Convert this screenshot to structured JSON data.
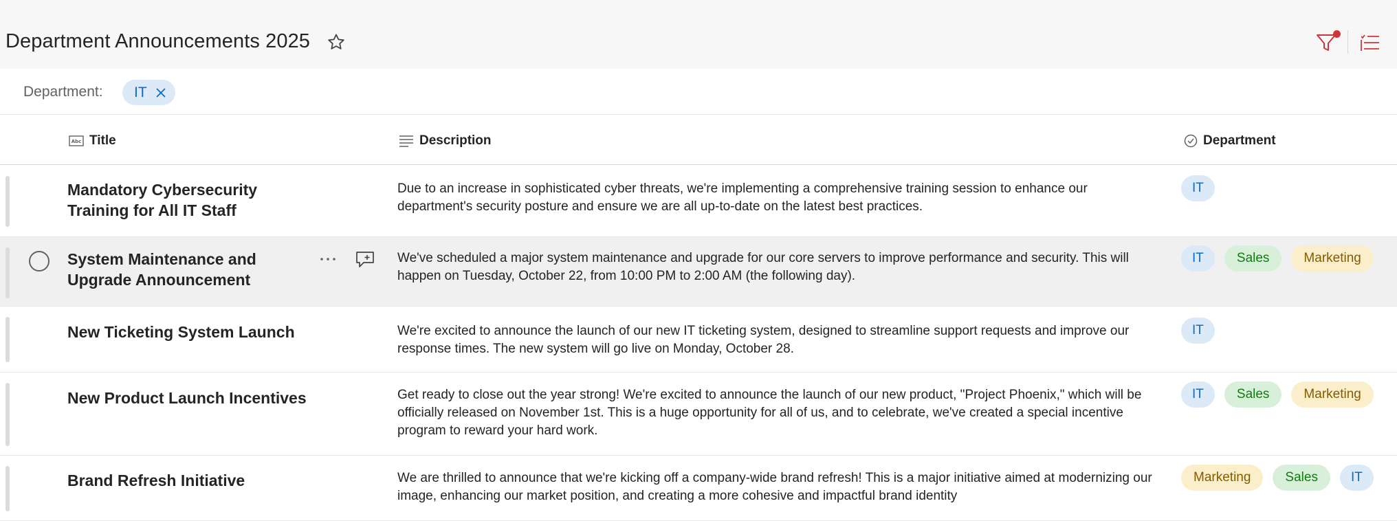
{
  "header": {
    "title": "Department Announcements 2025"
  },
  "filter": {
    "label": "Department:",
    "chip": "IT"
  },
  "columns": [
    {
      "label": "Title"
    },
    {
      "label": "Description"
    },
    {
      "label": "Department"
    }
  ],
  "rows": [
    {
      "title": "Mandatory Cybersecurity Training for All IT Staff",
      "description": "Due to an increase in sophisticated cyber threats, we're implementing a comprehensive training session to enhance our department's security posture and ensure we are all up-to-date on the latest best practices.",
      "tags": [
        "IT"
      ]
    },
    {
      "title": "System Maintenance and Upgrade Announcement",
      "description": "We've scheduled a major system maintenance and upgrade for our core servers to improve performance and security. This will happen on Tuesday, October 22, from 10:00 PM to 2:00 AM (the following day).",
      "tags": [
        "IT",
        "Sales",
        "Marketing"
      ]
    },
    {
      "title": "New Ticketing System Launch",
      "description": "We're excited to announce the launch of our new IT ticketing system, designed to streamline support requests and improve our response times. The new system will go live on Monday, October 28.",
      "tags": [
        "IT"
      ]
    },
    {
      "title": "New Product Launch Incentives",
      "description": "Get ready to close out the year strong! We're excited to announce the launch of our new product, \"Project Phoenix,\" which will be officially released on November 1st. This is a huge opportunity for all of us, and to celebrate, we've created a special incentive program to reward your hard work.",
      "tags": [
        "IT",
        "Sales",
        "Marketing"
      ]
    },
    {
      "title": "Brand Refresh Initiative",
      "description": "We are thrilled to announce that we're kicking off a company-wide brand refresh! This is a major initiative aimed at modernizing our image, enhancing our market position, and creating a more cohesive and impactful brand identity",
      "tags": [
        "Marketing",
        "Sales",
        "IT"
      ]
    }
  ],
  "colors": {
    "accent": "#0f6cbd",
    "filter_icon": "#d13438",
    "tag_it_bg": "#dce9f7",
    "tag_sales_bg": "#d8efd9",
    "tag_marketing_bg": "#fbeecb"
  },
  "icons": {
    "favorite": "star-icon",
    "filter": "filter-icon",
    "view": "list-view-icon",
    "title_column": "text-field-icon",
    "description_column": "multiline-text-icon",
    "department_column": "choice-check-icon",
    "row_more": "more-options-icon",
    "row_comment": "add-comment-icon",
    "chip_remove": "close-icon"
  }
}
